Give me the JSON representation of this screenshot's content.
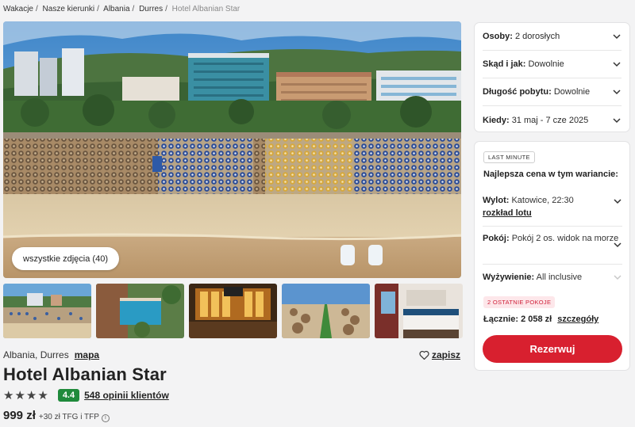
{
  "breadcrumb": {
    "items": [
      "Wakacje",
      "Nasze kierunki",
      "Albania",
      "Durres"
    ],
    "current": "Hotel Albanian Star"
  },
  "gallery": {
    "all_photos_label": "wszystkie zdjęcia (40)"
  },
  "hotel": {
    "location": "Albania, Durres",
    "map_link": "mapa",
    "save_label": "zapisz",
    "name": "Hotel Albanian Star",
    "stars": 4,
    "score": "4.4",
    "reviews": "548 opinii klientów",
    "price": "999 zł",
    "price_extra": "+30 zł TFG i TFP",
    "info_icon": "i"
  },
  "filters": [
    {
      "label": "Osoby:",
      "value": "2 dorosłych"
    },
    {
      "label": "Skąd i jak:",
      "value": "Dowolnie"
    },
    {
      "label": "Długość pobytu:",
      "value": "Dowolnie"
    },
    {
      "label": "Kiedy:",
      "value": "31 maj - 7 cze 2025"
    }
  ],
  "offer": {
    "badge": "LAST MINUTE",
    "best_price_label": "Najlepsza cena w tym wariancie:",
    "flight_label": "Wylot:",
    "flight_value": "Katowice, 22:30",
    "flight_link": "rozkład lotu",
    "room_label": "Pokój:",
    "room_value": "Pokój 2 os. widok na morze",
    "board_label": "Wyżywienie:",
    "board_value": "All inclusive",
    "rooms_left_badge": "2 OSTATNIE POKOJE",
    "total_label": "Łącznie:",
    "total_value": "2 058 zł",
    "details_link": "szczegóły",
    "book_button": "Rezerwuj"
  },
  "colors": {
    "accent": "#d8202f",
    "score_bg": "#1f8a3b",
    "page_bg": "#f3f3f4"
  }
}
